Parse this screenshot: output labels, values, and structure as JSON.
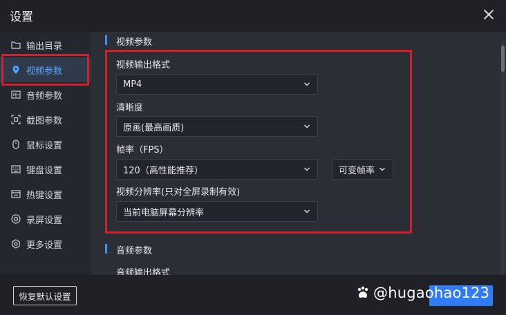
{
  "window": {
    "title": "设置"
  },
  "sidebar": {
    "items": [
      {
        "label": "输出目录",
        "icon": "folder-icon"
      },
      {
        "label": "视频参数",
        "icon": "video-param-icon",
        "active": true
      },
      {
        "label": "音频参数",
        "icon": "audio-icon"
      },
      {
        "label": "截图参数",
        "icon": "screenshot-icon"
      },
      {
        "label": "鼠标设置",
        "icon": "mouse-icon"
      },
      {
        "label": "键盘设置",
        "icon": "keyboard-icon"
      },
      {
        "label": "热键设置",
        "icon": "hotkey-icon"
      },
      {
        "label": "录屏设置",
        "icon": "record-icon"
      },
      {
        "label": "更多设置",
        "icon": "more-settings-icon"
      }
    ]
  },
  "video": {
    "section_title": "视频参数",
    "format": {
      "label": "视频输出格式",
      "value": "MP4"
    },
    "quality": {
      "label": "清晰度",
      "value": "原画(最高画质)"
    },
    "fps": {
      "label": "帧率（FPS）",
      "value": "120（高性能推荐）",
      "mode": "可变帧率"
    },
    "resolution": {
      "label": "视频分辨率(只对全屏录制有效)",
      "value": "当前电脑屏幕分辨率"
    }
  },
  "audio": {
    "section_title": "音频参数",
    "format_label": "音频输出格式"
  },
  "footer": {
    "reset_label": "恢复默认设置",
    "watermark": "@hugaohao123"
  },
  "colors": {
    "accent": "#2f7cf6",
    "highlight": "#d0202b",
    "active_text": "#5aa2ff"
  }
}
